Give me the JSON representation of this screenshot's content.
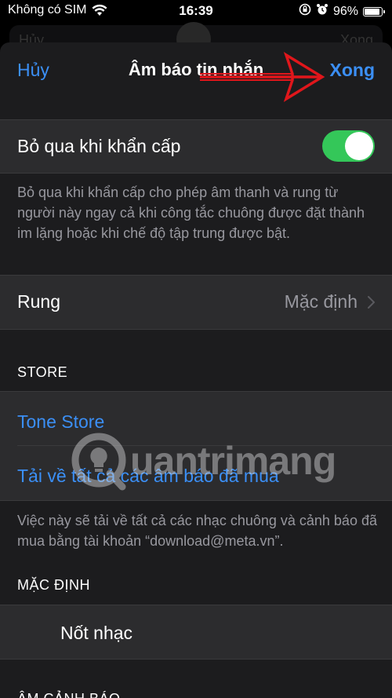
{
  "status_bar": {
    "carrier": "Không có SIM",
    "time": "16:39",
    "battery": "96%",
    "battery_level": 0.96
  },
  "background_sheet": {
    "left": "Hủy",
    "right": "Xong"
  },
  "nav": {
    "cancel_label": "Hủy",
    "title": "Âm báo tin nhắn",
    "done_label": "Xong"
  },
  "emergency_bypass": {
    "label": "Bỏ qua khi khẩn cấp",
    "enabled": true,
    "footer": "Bỏ qua khi khẩn cấp cho phép âm thanh và rung từ người này ngay cả khi công tắc chuông được đặt thành im lặng hoặc khi chế độ tập trung được bật."
  },
  "vibration": {
    "label": "Rung",
    "value": "Mặc định"
  },
  "store": {
    "header": "STORE",
    "tone_store": "Tone Store",
    "download_all": "Tải về tất cả các âm báo đã mua",
    "footer": "Việc này sẽ tải về tất cả các nhạc chuông và cảnh báo đã mua bằng tài khoản “download@meta.vn”."
  },
  "default_section": {
    "header": "MẶC ĐỊNH",
    "item": "Nốt nhạc"
  },
  "next_section": {
    "header": "ÂM CẢNH BÁO"
  },
  "watermark": {
    "text": "uantrimang"
  },
  "colors": {
    "accent": "#3b8ff6",
    "toggle_on": "#34c759",
    "annotation": "#e0161b"
  }
}
